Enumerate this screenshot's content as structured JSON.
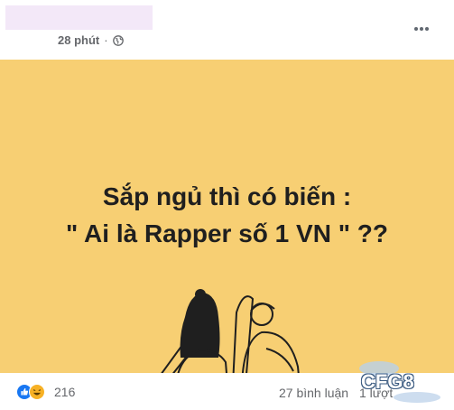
{
  "post": {
    "time": "28 phút",
    "separator": "·",
    "more_icon": "more-dots-icon",
    "privacy_icon": "globe-icon",
    "image": {
      "background": "#f7cf73",
      "line1": "Sắp ngủ thì có biến :",
      "line2": "\" Ai là Rapper số 1 VN \" ??"
    }
  },
  "footer": {
    "reaction_count": "216",
    "comments": "27 bình luận",
    "shares": "1 lượt",
    "reaction_icons": [
      "like-icon",
      "haha-icon"
    ]
  },
  "watermark": {
    "text": "CFG8"
  },
  "colors": {
    "accent": "#1877f2",
    "secondary_text": "#65676b",
    "haha": "#f7b125"
  }
}
